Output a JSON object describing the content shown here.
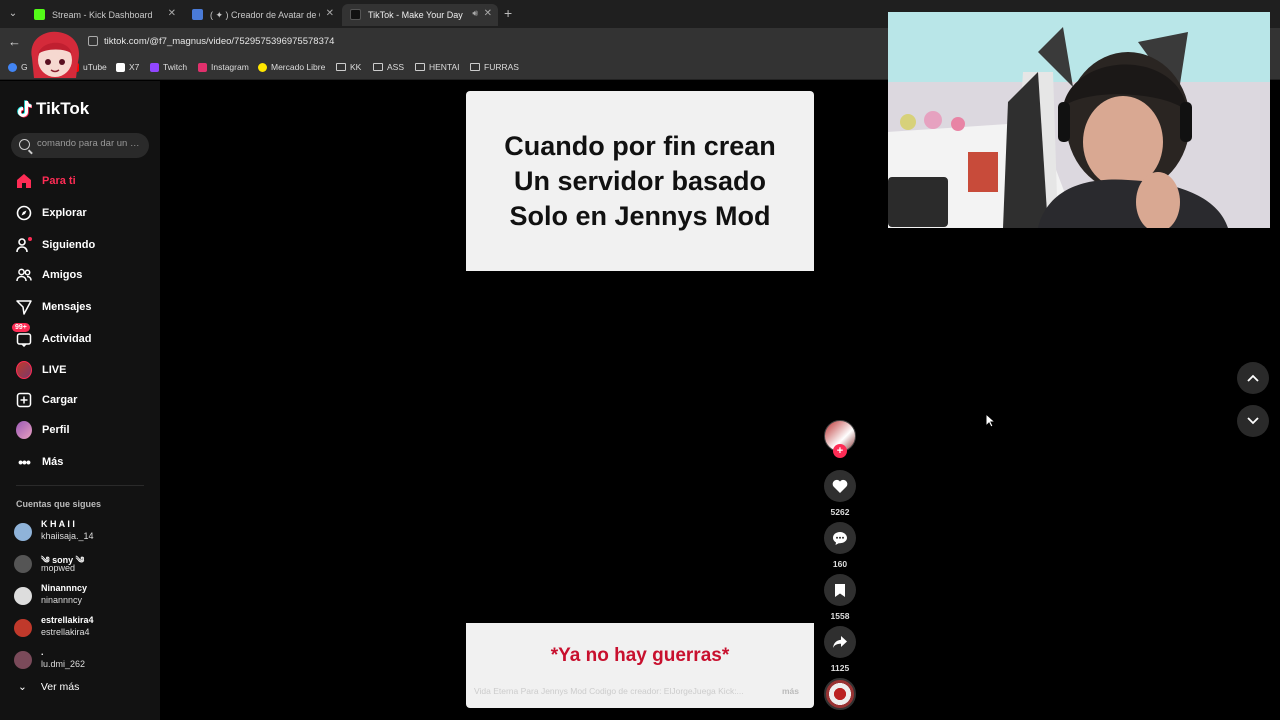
{
  "browser": {
    "tabs": [
      {
        "title": "Stream - Kick Dashboard",
        "color": "#53fc18"
      },
      {
        "title": "( ✦ ) Creador de Avatar de Catá…",
        "color": "#4a7bd8"
      },
      {
        "title": "TikTok - Make Your Day",
        "color": "#111111"
      }
    ],
    "url": "tiktok.com/@f7_magnus/video/7529575396975578374",
    "bookmarks": [
      {
        "label": "G",
        "color": "#4285f4"
      },
      {
        "label": "uTube",
        "color": "#ff0000"
      },
      {
        "label": "X7",
        "color": "#ffffff"
      },
      {
        "label": "Twitch",
        "color": "#9146ff"
      },
      {
        "label": "Instagram",
        "color": "#e1306c"
      },
      {
        "label": "Mercado Libre",
        "color": "#ffe600"
      },
      {
        "label": "KK",
        "type": "folder"
      },
      {
        "label": "ASS",
        "type": "folder"
      },
      {
        "label": "HENTAI",
        "type": "folder"
      },
      {
        "label": "FURRAS",
        "type": "folder"
      }
    ]
  },
  "sidebar": {
    "logo": "TikTok",
    "search_placeholder": "comando para dar un …",
    "nav": [
      {
        "label": "Para ti",
        "icon": "home-icon",
        "active": true
      },
      {
        "label": "Explorar",
        "icon": "compass-icon"
      },
      {
        "label": "Siguiendo",
        "icon": "following-icon"
      },
      {
        "label": "Amigos",
        "icon": "friends-icon"
      },
      {
        "label": "Mensajes",
        "icon": "send-icon"
      },
      {
        "label": "Actividad",
        "icon": "activity-icon",
        "badge": "99+"
      },
      {
        "label": "LIVE",
        "icon": "live-avatar-icon"
      },
      {
        "label": "Cargar",
        "icon": "upload-icon"
      },
      {
        "label": "Perfil",
        "icon": "profile-avatar-icon"
      },
      {
        "label": "Más",
        "icon": "more-icon"
      }
    ],
    "following_title": "Cuentas que sigues",
    "accounts": [
      {
        "name": "K H A I I",
        "handle": "khaiisaja._14",
        "color": "#8fb3d9"
      },
      {
        "name": "༄ sony ༄",
        "handle": "mopwed",
        "color": "#555555"
      },
      {
        "name": "Ninannncy",
        "handle": "ninannncy",
        "color": "#dddddd"
      },
      {
        "name": "estrellakira4",
        "handle": "estrellakira4",
        "color": "#c0392b"
      },
      {
        "name": ".",
        "handle": "lu.dmi_262",
        "color": "#7a4a5a"
      }
    ],
    "see_more": "Ver más"
  },
  "video": {
    "headline_lines": [
      "Cuando por fin crean",
      "Un servidor basado",
      "Solo en Jennys Mod"
    ],
    "red_text": "*Ya no hay guerras*",
    "caption": "Vida Eterna Para Jennys Mod Codigo de creador: ElJorgeJuega  Kick:...",
    "more": "más"
  },
  "actions": {
    "likes": "5262",
    "comments": "160",
    "saves": "1558",
    "shares": "1125"
  },
  "colors": {
    "accent": "#fe2c55",
    "sidebar_bg": "#121212",
    "card_bg": "#f1f1f1",
    "red_text": "#c8102e"
  }
}
